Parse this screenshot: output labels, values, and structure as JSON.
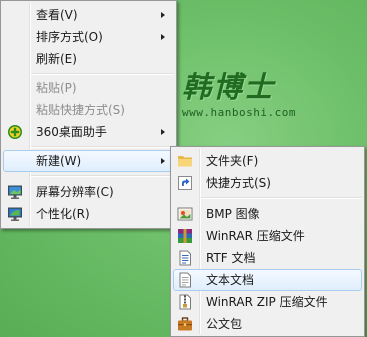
{
  "watermark": {
    "title": "韩博士",
    "url": "www.hanboshi.com"
  },
  "context_menu": {
    "items": [
      {
        "label": "查看(V)"
      },
      {
        "label": "排序方式(O)"
      },
      {
        "label": "刷新(E)"
      },
      {
        "label": "粘贴(P)"
      },
      {
        "label": "粘贴快捷方式(S)"
      },
      {
        "label": "360桌面助手"
      },
      {
        "label": "新建(W)"
      },
      {
        "label": "屏幕分辨率(C)"
      },
      {
        "label": "个性化(R)"
      }
    ]
  },
  "new_submenu": {
    "items": [
      {
        "label": "文件夹(F)"
      },
      {
        "label": "快捷方式(S)"
      },
      {
        "label": "BMP 图像"
      },
      {
        "label": "WinRAR 压缩文件"
      },
      {
        "label": "RTF 文档"
      },
      {
        "label": "文本文档"
      },
      {
        "label": "WinRAR ZIP 压缩文件"
      },
      {
        "label": "公文包"
      }
    ]
  }
}
